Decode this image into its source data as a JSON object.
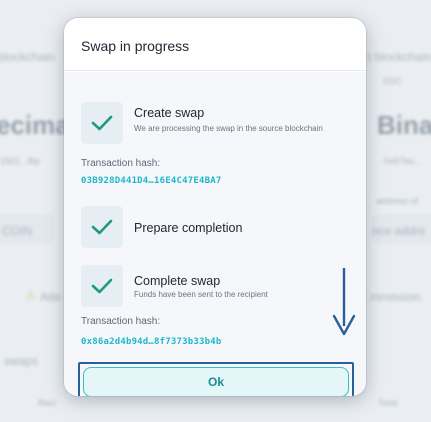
{
  "background": {
    "left_blockchain": "blockchain",
    "right_blockchain": "t blockchain",
    "right_small": "DSC",
    "left_big": "ecima",
    "right_big": "Binar",
    "left_addr": "1501...8tp",
    "right_addr": "0x67bo...",
    "left_coin": "COIN",
    "right_address": "nce addre",
    "right_address_small": "address of",
    "warning_text": "Atte",
    "right_commission": "mmission",
    "swaps": "swaps",
    "bottom_left": "Reci",
    "bottom_right": "Time"
  },
  "modal": {
    "title": "Swap in progress",
    "steps": [
      {
        "title": "Create swap",
        "description": "We are processing the swap in the source blockchain",
        "hash_label": "Transaction hash:",
        "hash_value": "03B928D441D4…16E4C47E4BA7",
        "status_icon": "check-icon"
      },
      {
        "title": "Prepare completion",
        "status_icon": "check-icon"
      },
      {
        "title": "Complete swap",
        "description": "Funds have been sent to the recipient",
        "hash_label": "Transaction hash:",
        "hash_value": "0x86a2d4b94d…8f7373b33b4b",
        "status_icon": "check-icon"
      }
    ],
    "ok_label": "Ok"
  },
  "colors": {
    "check": "#1f9a82",
    "hash": "#1fb7c9",
    "arrow": "#2c5f9a"
  }
}
